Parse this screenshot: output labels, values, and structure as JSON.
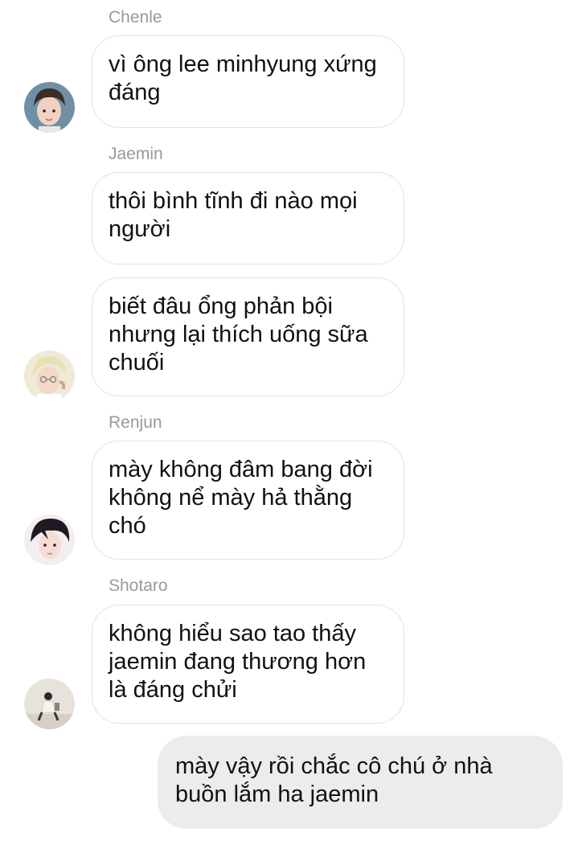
{
  "messages": [
    {
      "sender": "Chenle",
      "bubbles": [
        {
          "lines": [
            "vì ông lee minhyung xứng",
            "đáng"
          ]
        }
      ]
    },
    {
      "sender": "Jaemin",
      "bubbles": [
        {
          "lines": [
            "thôi bình tĩnh đi nào mọi",
            "người"
          ]
        },
        {
          "lines": [
            "biết đâu ổng phản bội",
            "nhưng lại thích uống sữa",
            "chuối"
          ]
        }
      ]
    },
    {
      "sender": "Renjun",
      "bubbles": [
        {
          "lines": [
            "mày không đâm bang đời",
            "không nể mày hả thằng",
            "chó"
          ]
        }
      ]
    },
    {
      "sender": "Shotaro",
      "bubbles": [
        {
          "lines": [
            "không hiểu sao tao thấy",
            "jaemin đang thương hơn",
            "là đáng chửi"
          ]
        }
      ]
    }
  ],
  "outgoing": {
    "lines": [
      "mày vậy rồi chắc cô chú ở nhà",
      "buồn lắm ha jaemin"
    ]
  },
  "colors": {
    "sender_name": "#9a9a9a",
    "incoming_border": "#e3e3e3",
    "outgoing_bg": "#ececec",
    "text": "#111111"
  }
}
